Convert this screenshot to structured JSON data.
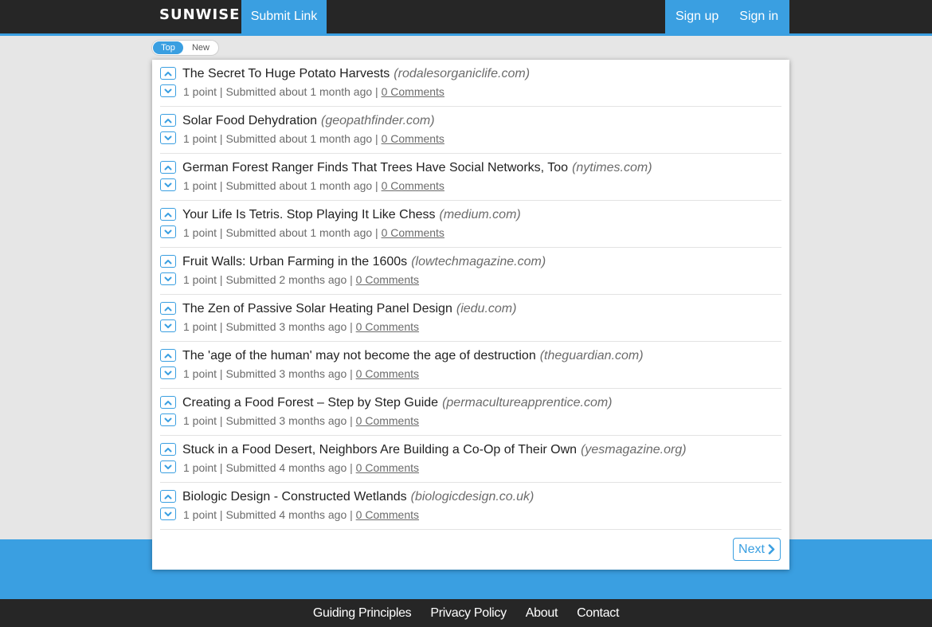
{
  "header": {
    "logo": "SUNWISE",
    "submit_label": "Submit Link",
    "signup_label": "Sign up",
    "signin_label": "Sign in"
  },
  "sort_toggle": {
    "top_label": "Top",
    "new_label": "New",
    "selected": "Top"
  },
  "icons": {
    "upvote": "chevron-up-icon",
    "downvote": "chevron-down-icon",
    "next": "chevron-right-icon"
  },
  "colors": {
    "accent": "#3a9fe1",
    "dark": "#262626",
    "page_bg": "#e6e6e6"
  },
  "posts": [
    {
      "title": "The Secret To Huge Potato Harvests",
      "domain": "(rodalesorganiclife.com)",
      "points": "1 point",
      "submitted": "Submitted about 1 month ago",
      "comments": "0 Comments"
    },
    {
      "title": "Solar Food Dehydration",
      "domain": "(geopathfinder.com)",
      "points": "1 point",
      "submitted": "Submitted about 1 month ago",
      "comments": "0 Comments"
    },
    {
      "title": "German Forest Ranger Finds That Trees Have Social Networks, Too",
      "domain": "(nytimes.com)",
      "points": "1 point",
      "submitted": "Submitted about 1 month ago",
      "comments": "0 Comments"
    },
    {
      "title": "Your Life Is Tetris. Stop Playing It Like Chess",
      "domain": "(medium.com)",
      "points": "1 point",
      "submitted": "Submitted about 1 month ago",
      "comments": "0 Comments"
    },
    {
      "title": "Fruit Walls: Urban Farming in the 1600s",
      "domain": "(lowtechmagazine.com)",
      "points": "1 point",
      "submitted": "Submitted 2 months ago",
      "comments": "0 Comments"
    },
    {
      "title": "The Zen of Passive Solar Heating Panel Design",
      "domain": "(iedu.com)",
      "points": "1 point",
      "submitted": "Submitted 3 months ago",
      "comments": "0 Comments"
    },
    {
      "title": "The 'age of the human' may not become the age of destruction",
      "domain": "(theguardian.com)",
      "points": "1 point",
      "submitted": "Submitted 3 months ago",
      "comments": "0 Comments"
    },
    {
      "title": "Creating a Food Forest – Step by Step Guide",
      "domain": "(permacultureapprentice.com)",
      "points": "1 point",
      "submitted": "Submitted 3 months ago",
      "comments": "0 Comments"
    },
    {
      "title": "Stuck in a Food Desert, Neighbors Are Building a Co-Op of Their Own",
      "domain": "(yesmagazine.org)",
      "points": "1 point",
      "submitted": "Submitted 4 months ago",
      "comments": "0 Comments"
    },
    {
      "title": "Biologic Design - Constructed Wetlands",
      "domain": "(biologicdesign.co.uk)",
      "points": "1 point",
      "submitted": "Submitted 4 months ago",
      "comments": "0 Comments"
    }
  ],
  "pagination": {
    "next_label": "Next"
  },
  "footer": {
    "links": [
      "Guiding Principles",
      "Privacy Policy",
      "About",
      "Contact"
    ]
  }
}
